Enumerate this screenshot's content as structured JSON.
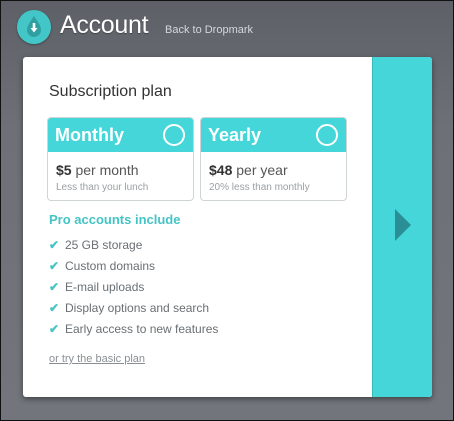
{
  "header": {
    "title": "Account",
    "back_link": "Back to Dropmark"
  },
  "subscription": {
    "title": "Subscription plan",
    "plans": [
      {
        "name": "Monthly",
        "price": "$5",
        "period": "per month",
        "note": "Less than your lunch"
      },
      {
        "name": "Yearly",
        "price": "$48",
        "period": "per year",
        "note": "20% less than monthly"
      }
    ]
  },
  "pro": {
    "title": "Pro accounts include",
    "features": [
      "25 GB storage",
      "Custom domains",
      "E-mail uploads",
      "Display options and search",
      "Early access to new features"
    ]
  },
  "basic_link": "or try the basic plan",
  "colors": {
    "accent": "#44d6d9",
    "accent_text": "#45c4c6",
    "arrow": "#2a8e96",
    "background": "#6d7177"
  },
  "icons": {
    "logo": "dropmark-logo-icon",
    "next": "arrow-right-icon",
    "check": "check-icon"
  }
}
